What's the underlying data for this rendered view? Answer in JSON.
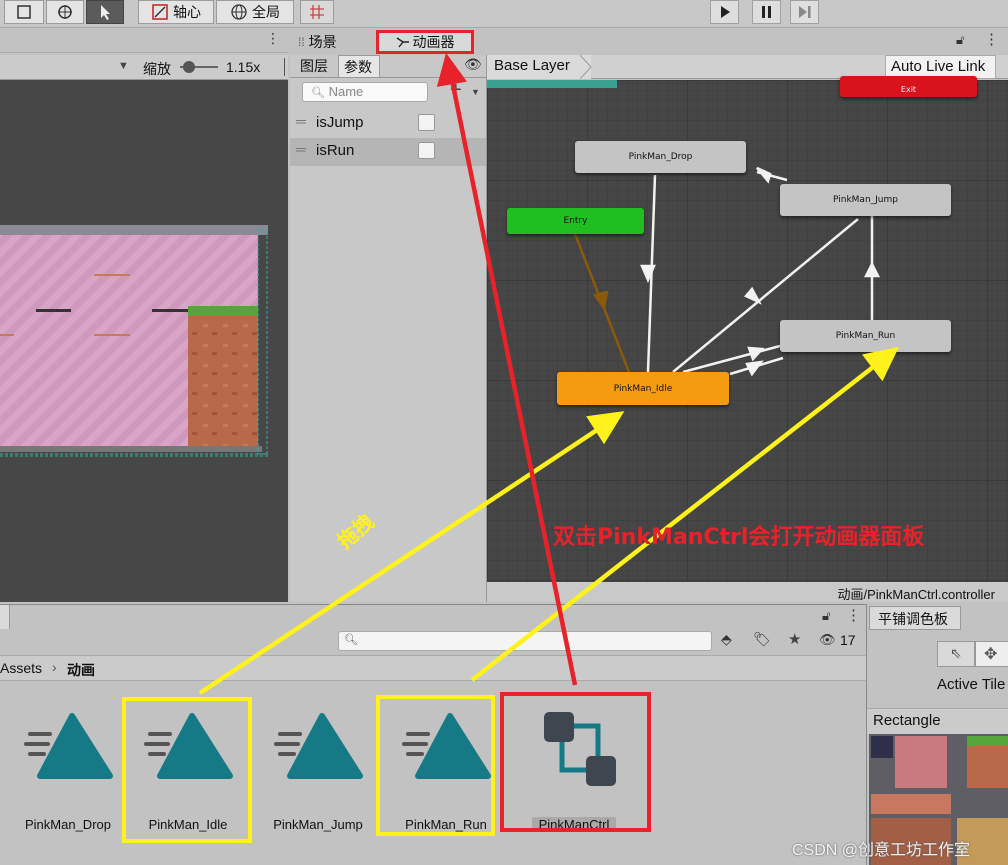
{
  "toolbar": {
    "pivot_label": "轴心",
    "global_label": "全局"
  },
  "scene": {
    "zoom_label": "缩放",
    "zoom_value": "1.15x"
  },
  "animator": {
    "tab_scene": "场景",
    "tab_animator": "动画器",
    "tab_layers": "图层",
    "tab_parameters": "参数",
    "search_placeholder": "Name",
    "parameters": [
      {
        "name": "isJump"
      },
      {
        "name": "isRun"
      }
    ],
    "breadcrumb": "Base Layer",
    "auto_live_link": "Auto Live Link",
    "footer_path": "动画/PinkManCtrl.controller",
    "states": {
      "exit": "Exit",
      "drop": "PinkMan_Drop",
      "jump": "PinkMan_Jump",
      "entry": "Entry",
      "run": "PinkMan_Run",
      "idle": "PinkMan_Idle"
    }
  },
  "project": {
    "breadcrumb_root": "Assets",
    "breadcrumb_folder": "动画",
    "count": "17",
    "assets": [
      {
        "label": "PinkMan_Drop"
      },
      {
        "label": "PinkMan_Idle"
      },
      {
        "label": "PinkMan_Jump"
      },
      {
        "label": "PinkMan_Run"
      },
      {
        "label": "PinkManCtrl"
      }
    ]
  },
  "palette": {
    "tab": "平铺调色板",
    "active_tilemap": "Active Tile",
    "tile_name": "Rectangle"
  },
  "annotations": {
    "drag_label": "拖拽",
    "double_click_note": "双击PinkManCtrl会打开动画器面板"
  },
  "watermark": "CSDN @创意工坊工作室",
  "colors": {
    "annotation_red": "#e8222a",
    "annotation_yellow": "#fff21a",
    "idle_state": "#f39c12",
    "entry_state": "#1fbf1f",
    "exit_state": "#d9131b",
    "anim_clip_teal": "#167a86"
  }
}
